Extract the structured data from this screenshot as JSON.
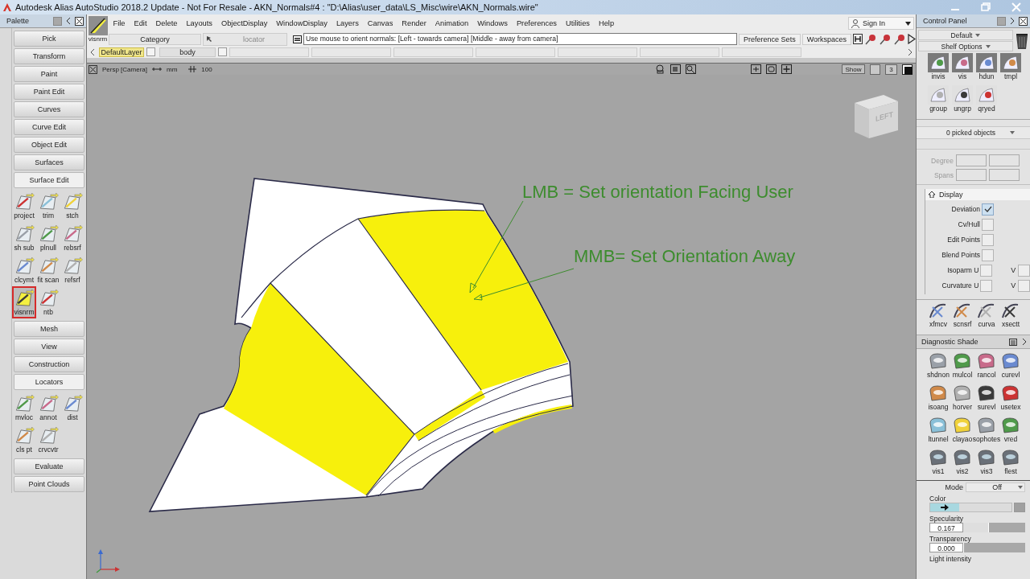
{
  "window": {
    "title": "Autodesk Alias AutoStudio 2018.2 Update - Not For Resale   - AKN_Normals#4 : \"D:\\Alias\\user_data\\LS_Misc\\wire\\AKN_Normals.wire\""
  },
  "palette": {
    "title": "Palette",
    "sections": [
      {
        "label": "Pick"
      },
      {
        "label": "Transform"
      },
      {
        "label": "Paint"
      },
      {
        "label": "Paint Edit"
      },
      {
        "label": "Curves"
      },
      {
        "label": "Curve Edit"
      },
      {
        "label": "Object Edit"
      },
      {
        "label": "Surfaces"
      },
      {
        "label": "Surface Edit",
        "tools": [
          {
            "label": "project",
            "selected": false
          },
          {
            "label": "trim",
            "selected": false
          },
          {
            "label": "stch",
            "selected": false
          },
          {
            "label": "sh sub",
            "selected": false
          },
          {
            "label": "plnull",
            "selected": false
          },
          {
            "label": "rebsrf",
            "selected": false
          },
          {
            "label": "clcymt",
            "selected": false
          },
          {
            "label": "fit scan",
            "selected": false
          },
          {
            "label": "refsrf",
            "selected": false
          },
          {
            "label": "visnrm",
            "selected": true
          },
          {
            "label": "ntb",
            "selected": false
          }
        ]
      },
      {
        "label": "Mesh"
      },
      {
        "label": "View"
      },
      {
        "label": "Construction"
      },
      {
        "label": "Locators",
        "tools": [
          {
            "label": "mvloc",
            "selected": false
          },
          {
            "label": "annot",
            "selected": false
          },
          {
            "label": "dist",
            "selected": false
          },
          {
            "label": "cls pt",
            "selected": false
          },
          {
            "label": "crvcvtr",
            "selected": false
          }
        ]
      },
      {
        "label": "Evaluate"
      },
      {
        "label": "Point Clouds"
      }
    ]
  },
  "current_tool": "visnrm",
  "menu": [
    "File",
    "Edit",
    "Delete",
    "Layouts",
    "ObjectDisplay",
    "WindowDisplay",
    "Layers",
    "Canvas",
    "Render",
    "Animation",
    "Windows",
    "Preferences",
    "Utilities",
    "Help"
  ],
  "sign_in": "Sign In",
  "toolbar": {
    "category": "Category",
    "locator": "locator",
    "prompt": "Use mouse to orient normals: [Left - towards camera] [Middle - away from camera]",
    "buttons": [
      "Preference Sets",
      "Workspaces"
    ]
  },
  "layers": [
    {
      "label": "DefaultLayer",
      "selected": true,
      "checked": false
    },
    {
      "label": "body",
      "selected": false,
      "checked": false
    }
  ],
  "viewport": {
    "camera": "Persp [Camera]",
    "units": "mm",
    "zoom": "100",
    "show": "Show",
    "count": "3",
    "view_cube": "LEFT",
    "annotations": [
      {
        "text": "LMB = Set orientation Facing User"
      },
      {
        "text": "MMB= Set Orientation Away"
      }
    ]
  },
  "control_panel": {
    "title": "Control Panel",
    "preset": "Default",
    "shelf_options": "Shelf Options",
    "shelf": [
      "invis",
      "vis",
      "hdun",
      "tmpl",
      "group",
      "ungrp",
      "qryed"
    ],
    "picked": "0 picked objects",
    "fields": [
      "Degree",
      "Spans"
    ],
    "display": {
      "title": "Display",
      "options": [
        {
          "label": "Deviation",
          "checked": true
        },
        {
          "label": "Cv/Hull",
          "checked": false
        },
        {
          "label": "Edit Points",
          "checked": false
        },
        {
          "label": "Blend Points",
          "checked": false
        },
        {
          "label": "Isoparm U",
          "checked": false,
          "v_label": "V",
          "v_checked": false
        },
        {
          "label": "Curvature U",
          "checked": false,
          "v_label": "V",
          "v_checked": false
        }
      ]
    },
    "shelf2": [
      "xfmcv",
      "scnsrf",
      "curva",
      "xsectt"
    ],
    "diagnostic": {
      "title": "Diagnostic Shade",
      "tools": [
        "shdnon",
        "mulcol",
        "rancol",
        "curevl",
        "isoang",
        "horver",
        "surevl",
        "usetex",
        "ltunnel",
        "clayao",
        "sophotes",
        "vred",
        "vis1",
        "vis2",
        "vis3",
        "flest"
      ]
    },
    "mode": {
      "label": "Mode",
      "value": "Off"
    },
    "color": {
      "label": "Color",
      "level": 0.36
    },
    "specularity": {
      "label": "Specularity",
      "value": "0.167",
      "level": 0.4
    },
    "transparency": {
      "label": "Transparency",
      "value": "0.000",
      "level": 0
    },
    "light_intensity": {
      "label": "Light intensity"
    }
  }
}
